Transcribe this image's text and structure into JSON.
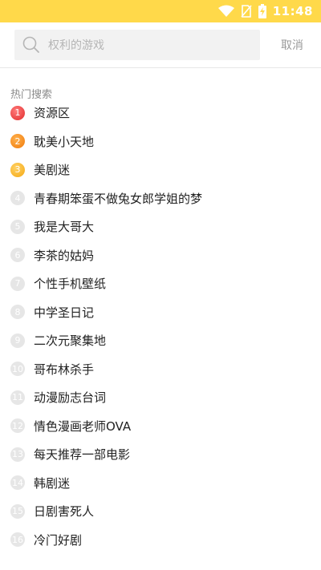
{
  "status_bar": {
    "time": "11:48",
    "icons": [
      "wifi-icon",
      "no-sim-icon",
      "battery-charging-icon"
    ]
  },
  "search": {
    "placeholder": "权利的游戏",
    "cancel_label": "取消",
    "icon": "search-icon"
  },
  "hot": {
    "title": "热门搜索",
    "items": [
      {
        "rank": "1",
        "label": "资源区"
      },
      {
        "rank": "2",
        "label": "耽美小天地"
      },
      {
        "rank": "3",
        "label": "美剧迷"
      },
      {
        "rank": "4",
        "label": "青春期笨蛋不做兔女郎学姐的梦"
      },
      {
        "rank": "5",
        "label": "我是大哥大"
      },
      {
        "rank": "6",
        "label": "李茶的姑妈"
      },
      {
        "rank": "7",
        "label": "个性手机壁纸"
      },
      {
        "rank": "8",
        "label": "中学圣日记"
      },
      {
        "rank": "9",
        "label": "二次元聚集地"
      },
      {
        "rank": "10",
        "label": "哥布林杀手"
      },
      {
        "rank": "11",
        "label": "动漫励志台词"
      },
      {
        "rank": "12",
        "label": "情色漫画老师OVA"
      },
      {
        "rank": "13",
        "label": "每天推荐一部电影"
      },
      {
        "rank": "14",
        "label": "韩剧迷"
      },
      {
        "rank": "15",
        "label": "日剧害死人"
      },
      {
        "rank": "16",
        "label": "冷门好剧"
      }
    ]
  },
  "colors": {
    "status_bar": "#ffd94a",
    "rank1": "#e12b2b",
    "rank2": "#f07a0a",
    "rank3": "#f5a812",
    "rank_other": "#e6e6e6"
  }
}
